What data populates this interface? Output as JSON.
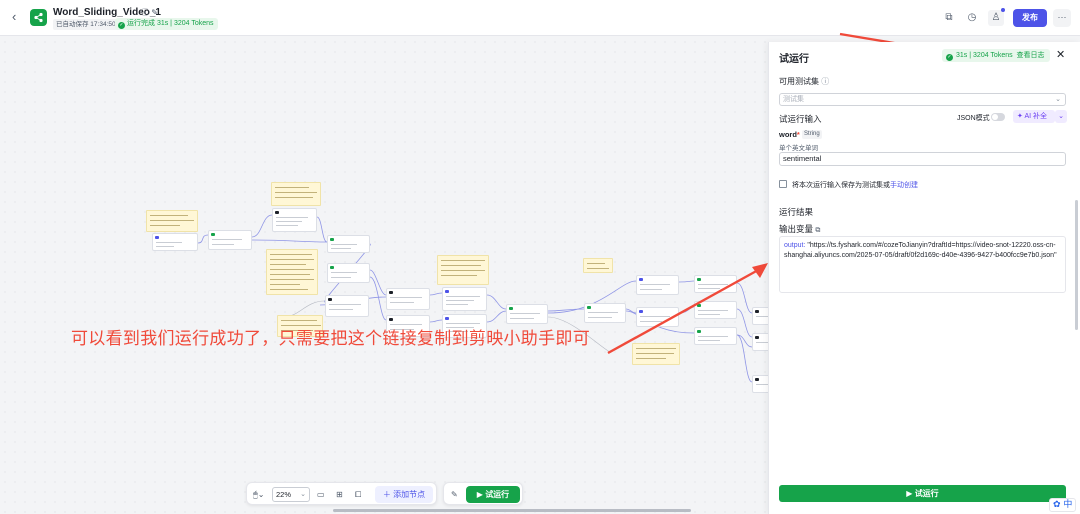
{
  "header": {
    "title": "Word_Sliding_Video_1",
    "autosave": "已自动保存 17:34:50",
    "run_status": "运行完成 31s | 3204 Tokens",
    "publish_label": "发布",
    "more_label": "···"
  },
  "canvas": {
    "annotation": "可以看到我们运行成功了，只需要把这个链接复制到剪映小助手即可"
  },
  "toolbar": {
    "zoom": "22%",
    "add_node_label": "添加节点",
    "run_label": "试运行"
  },
  "panel": {
    "title": "试运行",
    "badge_time": "31s",
    "badge_tokens": "3204 Tokens",
    "badge_link": "查看日志",
    "test_set_label": "可用测试集",
    "test_set_placeholder": "测试集",
    "test_input_label": "试运行输入",
    "json_mode_label": "JSON模式",
    "ai_fill_label": "AI 补全",
    "field_name": "word",
    "field_type": "String",
    "field_desc": "单个英文单词",
    "field_value": "sentimental",
    "save_text": "将本次运行输入保存为测试集或",
    "save_link": "手动创建",
    "result_label": "运行结果",
    "output_var_label": "输出变量",
    "output_key": "output",
    "output_value": "\"https://ts.fyshark.com/#/cozeToJianyin?draftId=https://video-snot-12220.oss-cn-shanghai.aliyuncs.com/2025-07-05/draft/0f2d169c-d40e-4396-9427-b400fcc9e7b0.json\"",
    "run_button": "试运行"
  },
  "ime": "中",
  "colors": {
    "accent": "#4d53e8",
    "success": "#16a34a",
    "annotation": "#f04a3a"
  }
}
